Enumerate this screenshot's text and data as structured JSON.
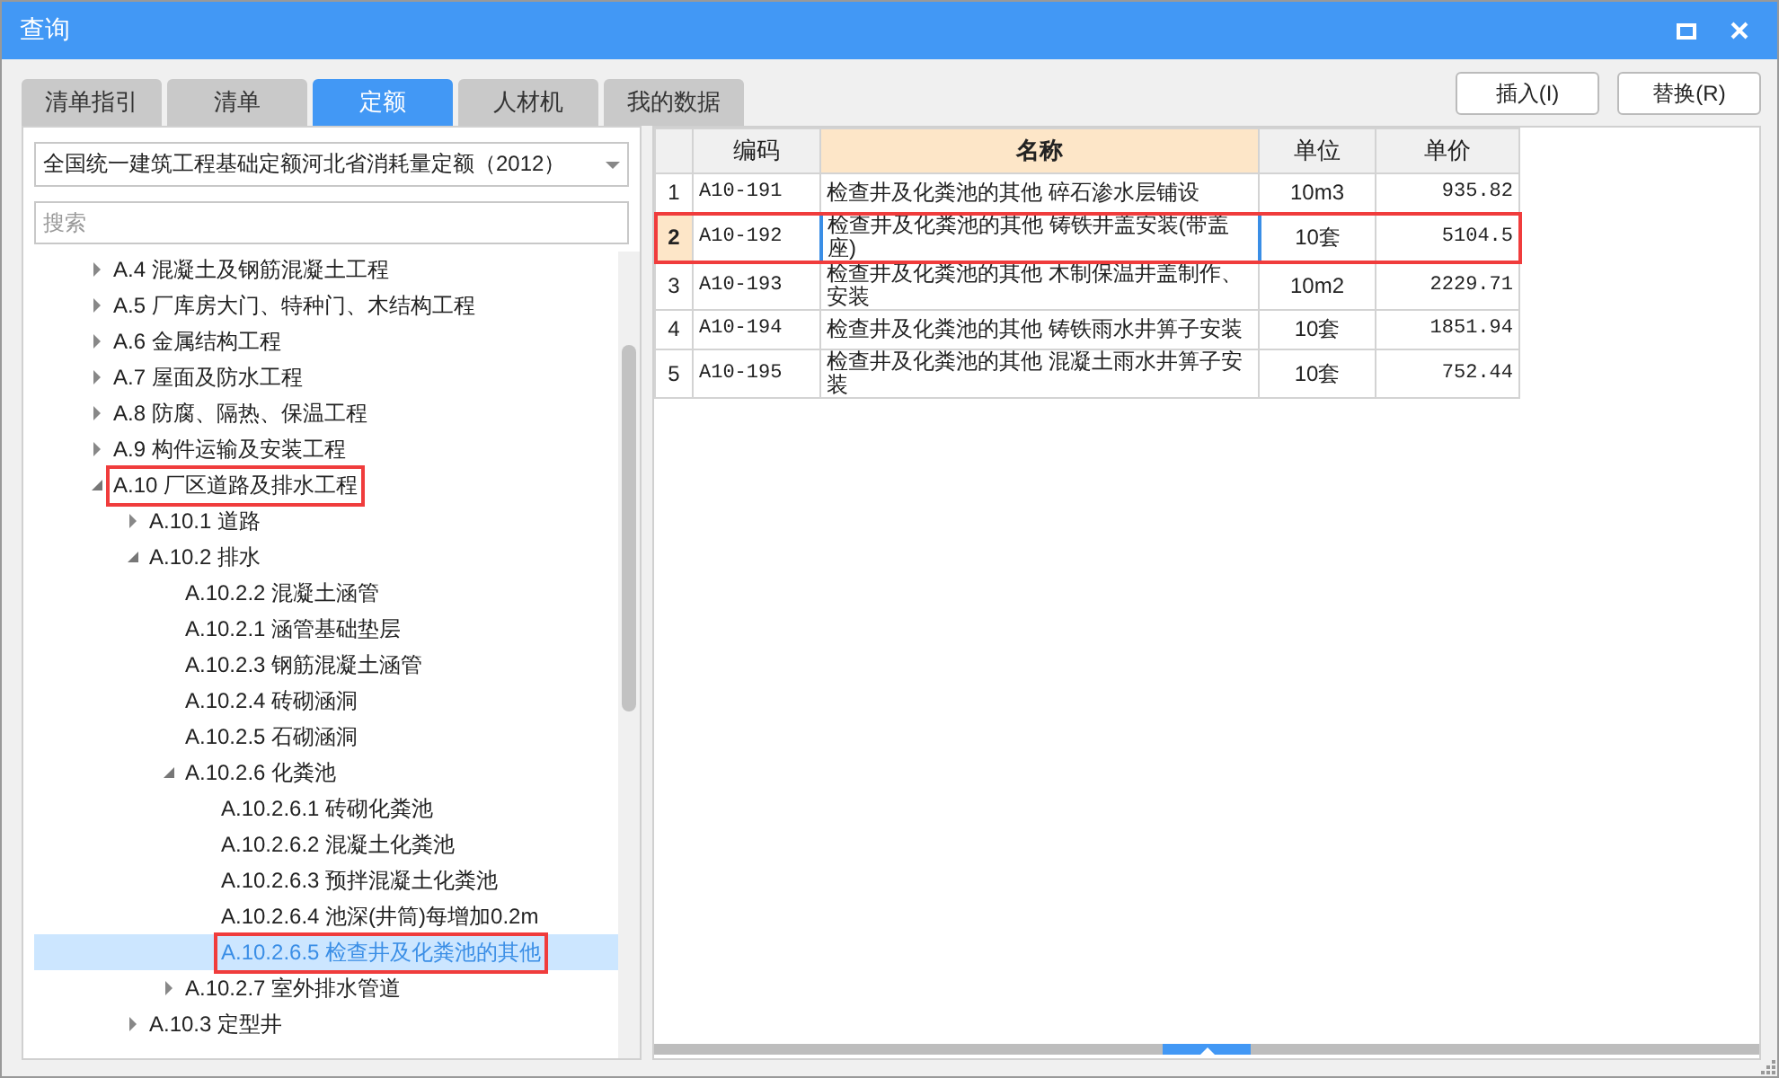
{
  "window": {
    "title": "查询"
  },
  "tabs": [
    {
      "label": "清单指引",
      "selected": false
    },
    {
      "label": "清单",
      "selected": false
    },
    {
      "label": "定额",
      "selected": true
    },
    {
      "label": "人材机",
      "selected": false
    },
    {
      "label": "我的数据",
      "selected": false
    }
  ],
  "buttons": [
    "插入(I)",
    "替换(R)"
  ],
  "library": {
    "value": "全国统一建筑工程基础定额河北省消耗量定额（2012）"
  },
  "search": {
    "placeholder": "搜索"
  },
  "tree": [
    {
      "label": "A.4 混凝土及钢筋混凝土工程",
      "expanded": false,
      "selected": false,
      "highlighted": false
    },
    {
      "label": "A.5 厂库房大门、特种门、木结构工程",
      "expanded": false,
      "selected": false,
      "highlighted": false
    },
    {
      "label": "A.6 金属结构工程",
      "expanded": false,
      "selected": false,
      "highlighted": false
    },
    {
      "label": "A.7 屋面及防水工程",
      "expanded": false,
      "selected": false,
      "highlighted": false
    },
    {
      "label": "A.8 防腐、隔热、保温工程",
      "expanded": false,
      "selected": false,
      "highlighted": false
    },
    {
      "label": "A.9 构件运输及安装工程",
      "expanded": false,
      "selected": false,
      "highlighted": false
    },
    {
      "label": "A.10 厂区道路及排水工程",
      "expanded": true,
      "selected": false,
      "highlighted": true,
      "children": [
        {
          "label": "A.10.1 道路",
          "expanded": false,
          "selected": false,
          "highlighted": false
        },
        {
          "label": "A.10.2 排水",
          "expanded": true,
          "selected": false,
          "highlighted": false,
          "children": [
            {
              "label": "A.10.2.2 混凝土涵管",
              "selected": false,
              "highlighted": false
            },
            {
              "label": "A.10.2.1 涵管基础垫层",
              "selected": false,
              "highlighted": false
            },
            {
              "label": "A.10.2.3 钢筋混凝土涵管",
              "selected": false,
              "highlighted": false
            },
            {
              "label": "A.10.2.4 砖砌涵洞",
              "selected": false,
              "highlighted": false
            },
            {
              "label": "A.10.2.5 石砌涵洞",
              "selected": false,
              "highlighted": false
            },
            {
              "label": "A.10.2.6 化粪池",
              "expanded": true,
              "selected": false,
              "highlighted": false,
              "children": [
                {
                  "label": "A.10.2.6.1 砖砌化粪池",
                  "selected": false,
                  "highlighted": false
                },
                {
                  "label": "A.10.2.6.2 混凝土化粪池",
                  "selected": false,
                  "highlighted": false
                },
                {
                  "label": "A.10.2.6.3 预拌混凝土化粪池",
                  "selected": false,
                  "highlighted": false
                },
                {
                  "label": "A.10.2.6.4 池深(井筒)每增加0.2m",
                  "selected": false,
                  "highlighted": false
                },
                {
                  "label": "A.10.2.6.5 检查井及化粪池的其他",
                  "selected": true,
                  "highlighted": true
                }
              ]
            },
            {
              "label": "A.10.2.7 室外排水管道",
              "expanded": false,
              "selected": false,
              "highlighted": false
            }
          ]
        },
        {
          "label": "A.10.3 定型井",
          "expanded": false,
          "selected": false,
          "highlighted": false
        }
      ]
    }
  ],
  "table": {
    "columns": [
      "编码",
      "名称",
      "单位",
      "单价"
    ],
    "rows": [
      {
        "index": "1",
        "code": "A10-191",
        "name": "检查井及化粪池的其他 碎石渗水层铺设",
        "unit": "10m3",
        "price": "935.82",
        "selected": false,
        "highlighted": false
      },
      {
        "index": "2",
        "code": "A10-192",
        "name": "检查井及化粪池的其他 铸铁井盖安装(带盖座)",
        "unit": "10套",
        "price": "5104.5",
        "selected": true,
        "highlighted": true
      },
      {
        "index": "3",
        "code": "A10-193",
        "name": "检查井及化粪池的其他 木制保温井盖制作、安装",
        "unit": "10m2",
        "price": "2229.71",
        "selected": false,
        "highlighted": false
      },
      {
        "index": "4",
        "code": "A10-194",
        "name": "检查井及化粪池的其他 铸铁雨水井箅子安装",
        "unit": "10套",
        "price": "1851.94",
        "selected": false,
        "highlighted": false
      },
      {
        "index": "5",
        "code": "A10-195",
        "name": "检查井及化粪池的其他 混凝土雨水井箅子安装",
        "unit": "10套",
        "price": "752.44",
        "selected": false,
        "highlighted": false
      }
    ]
  }
}
